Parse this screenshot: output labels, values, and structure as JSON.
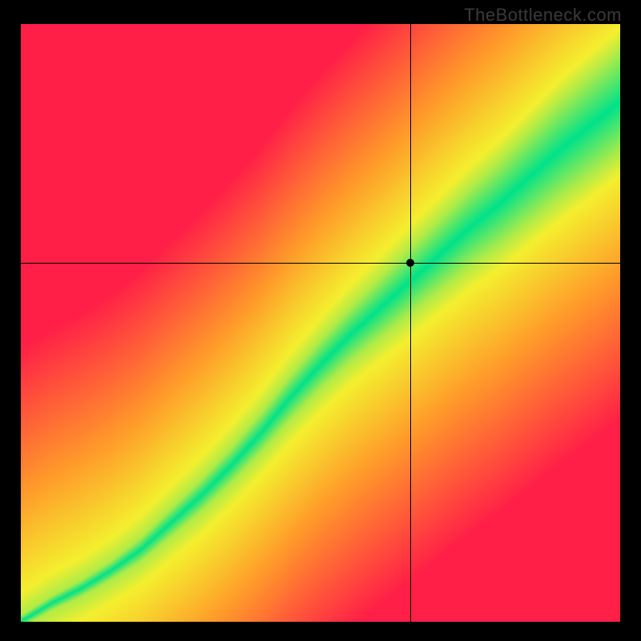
{
  "attribution": "TheBottleneck.com",
  "chart_data": {
    "type": "heatmap",
    "title": "",
    "xlabel": "",
    "ylabel": "",
    "xlim": [
      0,
      1
    ],
    "ylim": [
      0,
      1
    ],
    "crosshair": {
      "x": 0.65,
      "y": 0.6
    },
    "marker": {
      "x": 0.65,
      "y": 0.6
    },
    "optimal_band": {
      "description": "Green ridge roughly diagonal with slight S-curve; band widens toward upper-right.",
      "samples": [
        {
          "x": 0.0,
          "center_y": 0.0,
          "half_width": 0.01
        },
        {
          "x": 0.05,
          "center_y": 0.03,
          "half_width": 0.012
        },
        {
          "x": 0.1,
          "center_y": 0.055,
          "half_width": 0.014
        },
        {
          "x": 0.15,
          "center_y": 0.085,
          "half_width": 0.016
        },
        {
          "x": 0.2,
          "center_y": 0.12,
          "half_width": 0.02
        },
        {
          "x": 0.25,
          "center_y": 0.165,
          "half_width": 0.024
        },
        {
          "x": 0.3,
          "center_y": 0.21,
          "half_width": 0.027
        },
        {
          "x": 0.35,
          "center_y": 0.26,
          "half_width": 0.03
        },
        {
          "x": 0.4,
          "center_y": 0.315,
          "half_width": 0.033
        },
        {
          "x": 0.45,
          "center_y": 0.375,
          "half_width": 0.037
        },
        {
          "x": 0.5,
          "center_y": 0.43,
          "half_width": 0.041
        },
        {
          "x": 0.55,
          "center_y": 0.48,
          "half_width": 0.045
        },
        {
          "x": 0.6,
          "center_y": 0.525,
          "half_width": 0.05
        },
        {
          "x": 0.65,
          "center_y": 0.57,
          "half_width": 0.055
        },
        {
          "x": 0.7,
          "center_y": 0.615,
          "half_width": 0.06
        },
        {
          "x": 0.75,
          "center_y": 0.66,
          "half_width": 0.065
        },
        {
          "x": 0.8,
          "center_y": 0.7,
          "half_width": 0.07
        },
        {
          "x": 0.85,
          "center_y": 0.745,
          "half_width": 0.075
        },
        {
          "x": 0.9,
          "center_y": 0.79,
          "half_width": 0.08
        },
        {
          "x": 0.95,
          "center_y": 0.83,
          "half_width": 0.083
        },
        {
          "x": 1.0,
          "center_y": 0.87,
          "half_width": 0.085
        }
      ]
    },
    "color_scale": {
      "stops": [
        {
          "t": 0.0,
          "color": "#00e28a",
          "meaning": "optimal match (center of band)"
        },
        {
          "t": 0.25,
          "color": "#f4ef2e",
          "meaning": "near-optimal"
        },
        {
          "t": 0.55,
          "color": "#ff9a2a",
          "meaning": "moderate mismatch"
        },
        {
          "t": 1.0,
          "color": "#ff1f47",
          "meaning": "severe mismatch"
        }
      ]
    }
  }
}
